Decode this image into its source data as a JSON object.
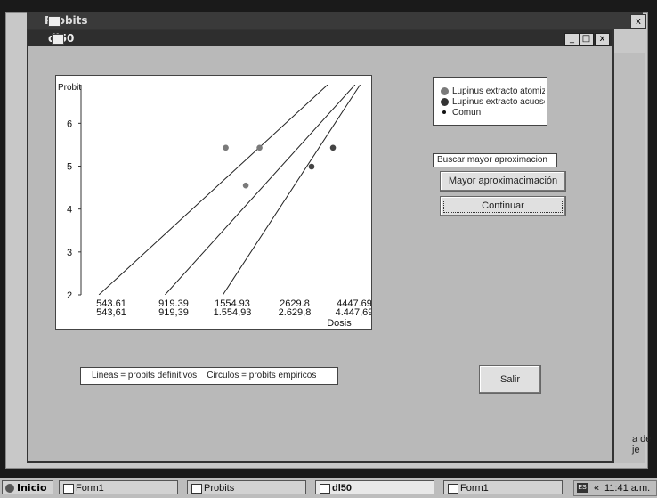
{
  "back_window": {
    "title": "Probits",
    "close_label": "x",
    "side_text": "a de\nje"
  },
  "main_window": {
    "title": "dl50",
    "min_label": "_",
    "max_label": "□",
    "close_label": "x"
  },
  "chart_data": {
    "type": "scatter",
    "title": "",
    "ylabel": "Probit",
    "xlabel": "Dosis",
    "ylim": [
      2,
      6.9
    ],
    "yticks": [
      2,
      3,
      4,
      5,
      6
    ],
    "xticks": [
      "543,61",
      "919,39",
      "1.554,93",
      "2.629,8",
      "4.447,69"
    ],
    "xticks_overdrawn": [
      "543,61",
      "919,39",
      "1554,93",
      "2629,8",
      "4447,69"
    ],
    "x_scale": "log",
    "points": [
      {
        "series": "Lupinus extracto atomizado",
        "x": 1490,
        "y": 5.43,
        "color": "#7a7a7a"
      },
      {
        "series": "Lupinus extracto atomizado",
        "x": 1800,
        "y": 4.55,
        "color": "#7a7a7a"
      },
      {
        "series": "Lupinus extracto atomizado",
        "x": 2050,
        "y": 5.43,
        "color": "#7a7a7a"
      },
      {
        "series": "Lupinus extracto acuoso",
        "x": 3350,
        "y": 4.99,
        "color": "#444444"
      },
      {
        "series": "Lupinus extracto acuoso",
        "x": 4100,
        "y": 5.43,
        "color": "#444444"
      }
    ],
    "lines": [
      {
        "x": [
          450,
          3900
        ],
        "y": [
          2.0,
          6.9
        ]
      },
      {
        "x": [
          840,
          5050
        ],
        "y": [
          2.0,
          6.9
        ]
      },
      {
        "x": [
          1450,
          5300
        ],
        "y": [
          2.0,
          6.9
        ]
      }
    ]
  },
  "legend": {
    "items": [
      {
        "label": "Lupinus extracto atomizado",
        "color": "#7a7a7a"
      },
      {
        "label": "Lupinus extracto acuoso",
        "color": "#333333"
      },
      {
        "label": "Comun",
        "color": "#111111"
      }
    ]
  },
  "controls": {
    "search_value": "Buscar mayor aproximacion",
    "mayor_button": "Mayor aproximacimación",
    "continuar_button": "Continuar",
    "salir_button": "Salir",
    "note": "Lineas = probits definitivos    Circulos = probits empiricos"
  },
  "taskbar": {
    "start": "Inicio",
    "tasks": [
      "Form1",
      "Probits",
      "dl50",
      "Form1"
    ],
    "tray_lang": "ES",
    "tray_arrows": "«",
    "clock": "11:41 a.m."
  }
}
